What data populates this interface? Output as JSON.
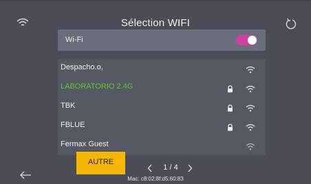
{
  "header": {
    "title": "Sélection WIFI"
  },
  "wifi_toggle": {
    "label": "Wi-Fi",
    "enabled": true,
    "on_color": "#d23fa0"
  },
  "networks": [
    {
      "name": "Despacho.o,",
      "locked": false,
      "active": false
    },
    {
      "name": "LABORATORIO 2.4G",
      "locked": true,
      "active": true
    },
    {
      "name": "TBK",
      "locked": true,
      "active": false
    },
    {
      "name": "FBLUE",
      "locked": true,
      "active": false
    },
    {
      "name": "Fermax Guest",
      "locked": false,
      "active": false
    }
  ],
  "footer": {
    "other_button": "AUTRE",
    "page_indicator": "1 / 4",
    "mac": "Mac: c8:02:8f:d5:60:83"
  },
  "colors": {
    "background": "#4a4d58",
    "active_network": "#5ec837",
    "accent_button": "#f5b700"
  },
  "icons": [
    "wifi-status-icon",
    "refresh-icon",
    "lock-icon",
    "wifi-signal-icon",
    "back-arrow-icon",
    "chevron-left-icon",
    "chevron-right-icon"
  ]
}
